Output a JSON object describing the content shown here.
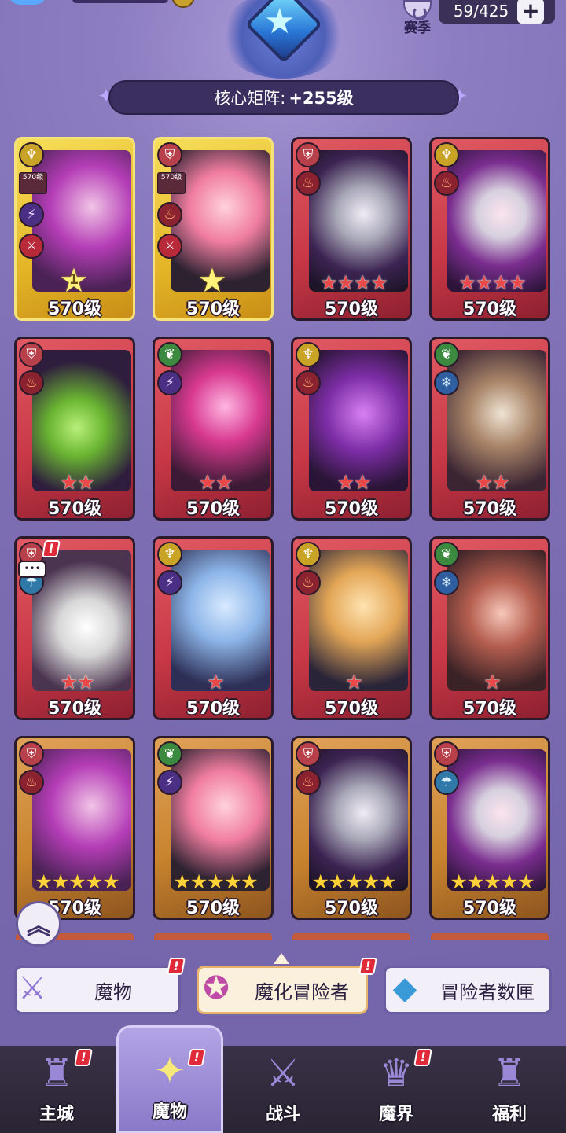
{
  "topbar": {
    "season_label": "赛季",
    "capacity": "59/425",
    "add_icon": "plus-icon",
    "season_icon": "season-icon"
  },
  "core_matrix": {
    "label": "核心矩阵:",
    "value": "+255级",
    "icon": "crystal-gem-icon"
  },
  "cards": [
    {
      "level": "570级",
      "frame": "gold",
      "class_icon": "mage-icon",
      "element_icon": "lightning-icon",
      "stars": "",
      "rank": "1",
      "mini_label": "570级",
      "has_skill_badge": true
    },
    {
      "level": "570级",
      "frame": "gold",
      "class_icon": "tank-icon",
      "element_icon": "fire-icon",
      "stars": "",
      "rank": "",
      "mini_label": "570级",
      "has_skill_badge": true
    },
    {
      "level": "570级",
      "frame": "red",
      "class_icon": "tank-icon",
      "element_icon": "fire-icon",
      "stars": "★★★★"
    },
    {
      "level": "570级",
      "frame": "red",
      "class_icon": "mage-icon",
      "element_icon": "fire-icon",
      "stars": "★★★★"
    },
    {
      "level": "570级",
      "frame": "red",
      "class_icon": "tank-icon",
      "element_icon": "fire-icon",
      "stars": "★★"
    },
    {
      "level": "570级",
      "frame": "red",
      "class_icon": "nature-icon",
      "element_icon": "lightning-icon",
      "stars": "★★"
    },
    {
      "level": "570级",
      "frame": "red",
      "class_icon": "mage-icon",
      "element_icon": "fire-icon",
      "stars": "★★"
    },
    {
      "level": "570级",
      "frame": "red",
      "class_icon": "nature-icon",
      "element_icon": "ice-icon",
      "stars": "★★"
    },
    {
      "level": "570级",
      "frame": "red",
      "class_icon": "tank-icon",
      "element_icon": "water-icon",
      "stars": "★★"
    },
    {
      "level": "570级",
      "frame": "red",
      "class_icon": "mage-icon",
      "element_icon": "lightning-icon",
      "stars": "★"
    },
    {
      "level": "570级",
      "frame": "red",
      "class_icon": "mage-icon",
      "element_icon": "fire-icon",
      "stars": "★"
    },
    {
      "level": "570级",
      "frame": "red",
      "class_icon": "nature-icon",
      "element_icon": "ice-icon",
      "stars": "★"
    },
    {
      "level": "570级",
      "frame": "bronze",
      "class_icon": "tank-icon",
      "element_icon": "fire-icon",
      "stars": "★★★★★"
    },
    {
      "level": "570级",
      "frame": "bronze",
      "class_icon": "nature-icon",
      "element_icon": "lightning-icon",
      "stars": "★★★★★"
    },
    {
      "level": "570级",
      "frame": "bronze",
      "class_icon": "tank-icon",
      "element_icon": "fire-icon",
      "stars": "★★★★★"
    },
    {
      "level": "570级",
      "frame": "bronze",
      "class_icon": "tank-icon",
      "element_icon": "water-icon",
      "stars": "★★★★★"
    }
  ],
  "category_tabs": [
    {
      "label": "魔物",
      "icon": "sword-icon",
      "active": false
    },
    {
      "label": "魔化冒险者",
      "icon": "star-badge-icon",
      "active": true
    },
    {
      "label": "冒险者数匣",
      "icon": "crystal-box-icon",
      "active": false
    }
  ],
  "bottom_nav": [
    {
      "label": "主城",
      "icon": "castle-icon"
    },
    {
      "label": "魔物",
      "icon": "monster-flame-icon"
    },
    {
      "label": "战斗",
      "icon": "crossed-swords-icon"
    },
    {
      "label": "魔界",
      "icon": "demon-gate-icon"
    },
    {
      "label": "福利",
      "icon": "gift-chest-icon"
    }
  ],
  "alert_mark": "!",
  "scroll_up_icon": "double-chevron-up-icon"
}
